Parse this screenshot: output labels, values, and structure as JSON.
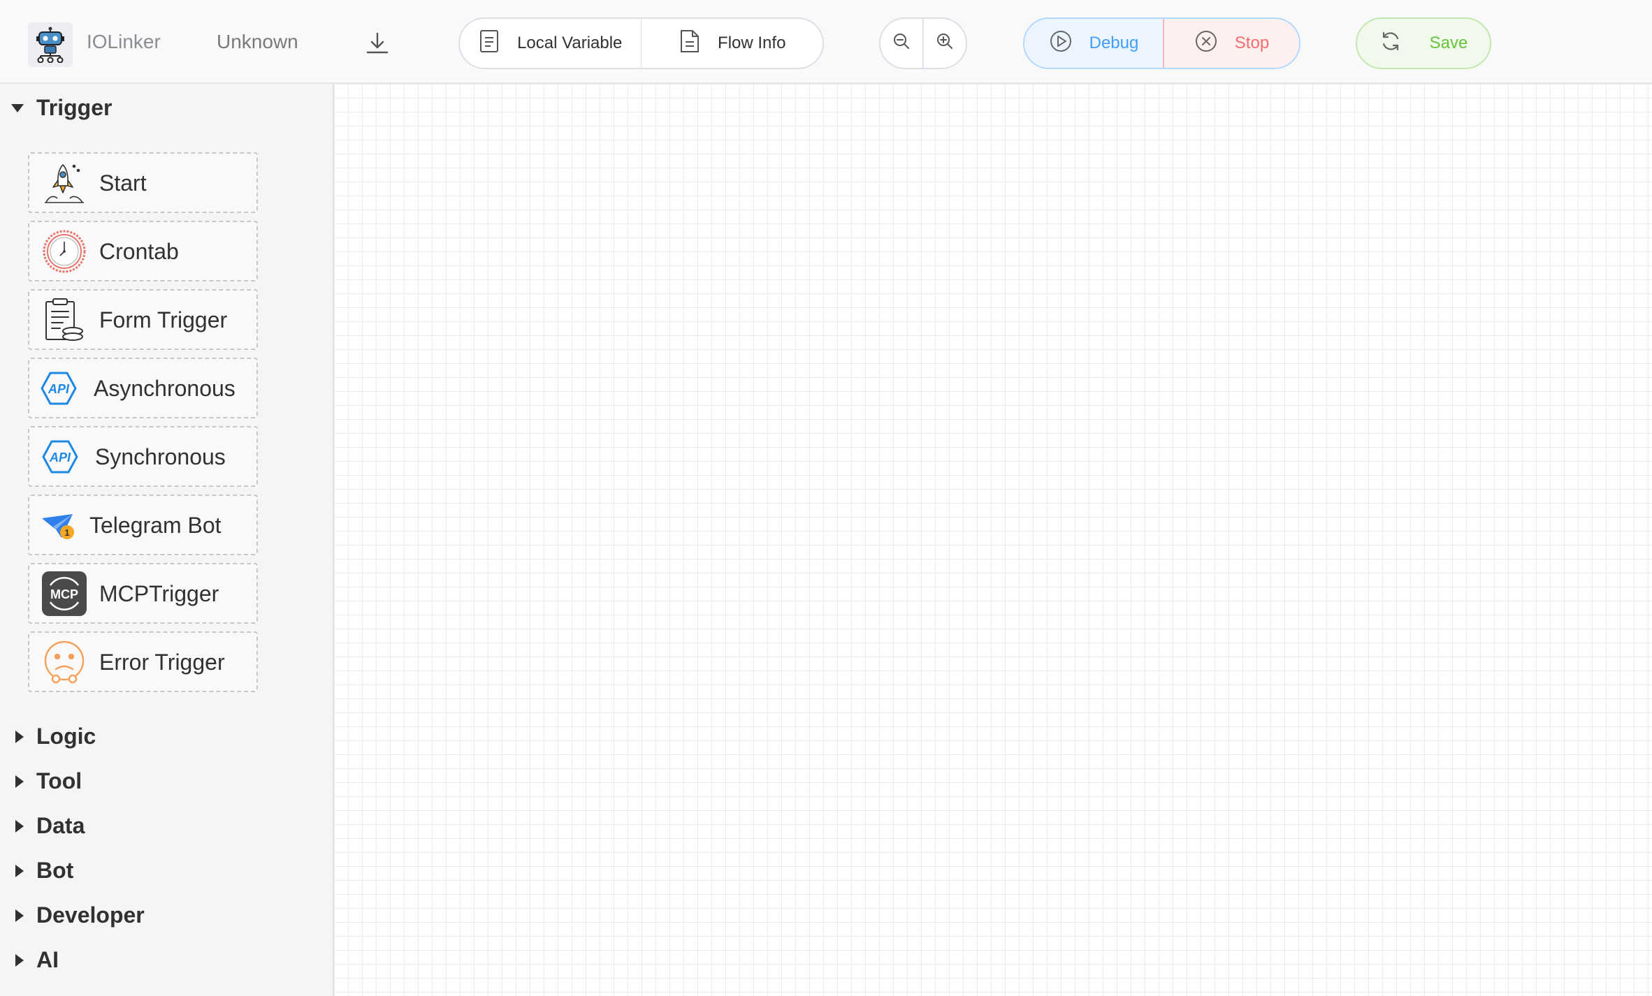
{
  "header": {
    "app_name": "IOLinker",
    "flow_name": "Unknown",
    "local_variable_label": "Local Variable",
    "flow_info_label": "Flow Info",
    "debug_label": "Debug",
    "stop_label": "Stop",
    "save_label": "Save",
    "icons": {
      "logo": "robot-logo-icon",
      "download": "download-icon",
      "local_variable": "document-icon",
      "flow_info": "document-icon",
      "zoom_out": "zoom-out-icon",
      "zoom_in": "zoom-in-icon",
      "debug": "play-icon",
      "stop": "close-circle-icon",
      "save": "refresh-icon"
    },
    "colors": {
      "debug": "#409eff",
      "stop": "#f56c6c",
      "save": "#67c23a"
    }
  },
  "sidebar": {
    "expanded_category": "Trigger",
    "trigger_items": [
      {
        "label": "Start",
        "icon": "rocket-icon"
      },
      {
        "label": "Crontab",
        "icon": "clock-icon"
      },
      {
        "label": "Form Trigger",
        "icon": "clipboard-icon"
      },
      {
        "label": "Asynchronous",
        "icon": "api-icon"
      },
      {
        "label": "Synchronous",
        "icon": "api-icon"
      },
      {
        "label": "Telegram Bot",
        "icon": "telegram-icon"
      },
      {
        "label": "MCPTrigger",
        "icon": "mcp-icon"
      },
      {
        "label": "Error Trigger",
        "icon": "sad-face-icon"
      }
    ],
    "collapsed_categories": [
      "Logic",
      "Tool",
      "Data",
      "Bot",
      "Developer",
      "AI"
    ]
  }
}
